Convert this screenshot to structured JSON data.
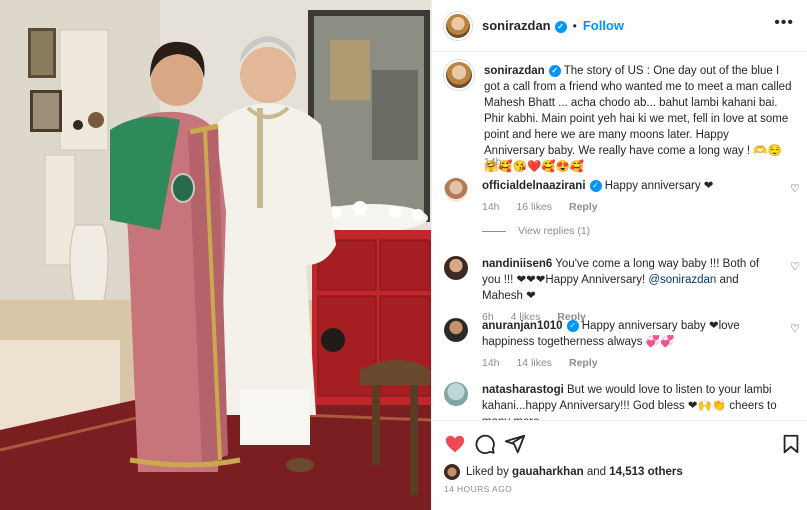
{
  "post": {
    "username": "sonirazdan",
    "follow_label": "Follow",
    "dot": "•",
    "more": "•••"
  },
  "caption": {
    "username": "sonirazdan",
    "text": "The story of US : One day out of the blue I got a call from a friend who wanted me to meet a man called Mahesh Bhatt ... acha chodo ab... bahut lambi kahani bai. Phir kabhi. Main point yeh hai ki we met, fell in love at some point and here we are many moons later. Happy Anniversary baby. We really have come a long way ! 🫶😌🤗🥰😘❤️🥰😍🥰",
    "time": "14h"
  },
  "comments": [
    {
      "username": "officialdelnaazirani",
      "verified": true,
      "text": "Happy anniversary ❤",
      "time": "14h",
      "likes": "16 likes",
      "reply": "Reply",
      "view_replies": "View replies (1)"
    },
    {
      "username": "nandiniisen6",
      "verified": false,
      "text_before": "You've come a long way baby !!! Both of you !!! ❤❤❤Happy Anniversary! ",
      "mention": "@sonirazdan",
      "text_after": " and Mahesh ❤",
      "time": "6h",
      "likes": "4 likes",
      "reply": "Reply"
    },
    {
      "username": "anuranjan1010",
      "verified": true,
      "text": "Happy anniversary baby ❤love happiness togetherness always 💞💞",
      "time": "14h",
      "likes": "14 likes",
      "reply": "Reply"
    },
    {
      "username": "natasharastogi",
      "verified": false,
      "text": "But we would love to listen to your lambi kahani...happy Anniversary!!! God bless ❤🙌👏 cheers to many more"
    }
  ],
  "actions": {
    "liked_by_prefix": "Liked by ",
    "liked_by_user": "gauaharkhan",
    "and_label": " and ",
    "others": "14,513 others",
    "ago": "14 HOURS AGO"
  },
  "colors": {
    "accent_blue": "#0095f6",
    "like_red": "#ed4956",
    "muted_gray": "#8e8e8e"
  },
  "icons": [
    "verified-badge-icon",
    "more-options-icon",
    "heart-icon",
    "comment-icon",
    "share-icon",
    "bookmark-icon"
  ]
}
